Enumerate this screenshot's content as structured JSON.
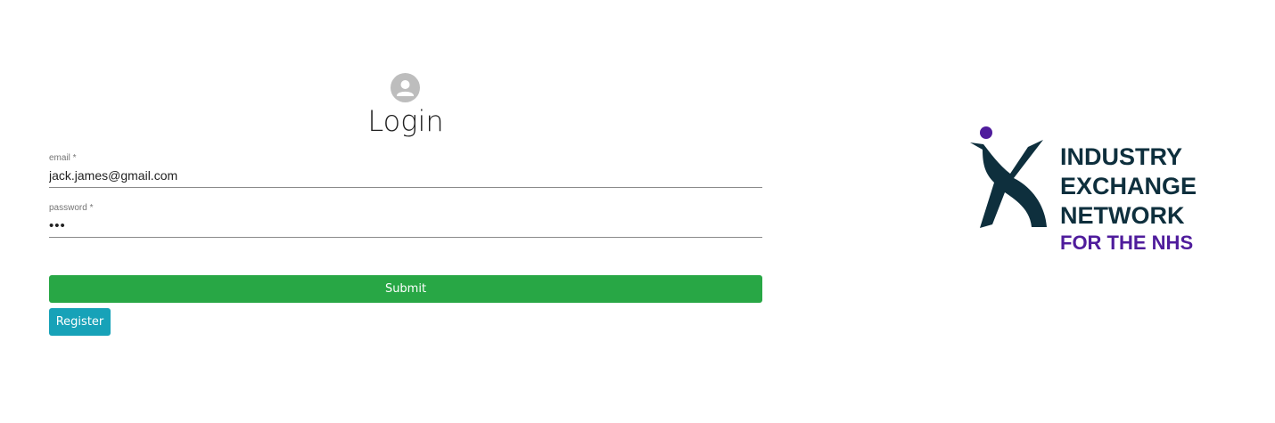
{
  "login": {
    "title": "Login",
    "avatar_icon": "account-circle-icon",
    "email": {
      "label": "email *",
      "value": "jack.james@gmail.com"
    },
    "password": {
      "label": "password *",
      "value": "abc"
    },
    "submit_label": "Submit",
    "register_label": "Register"
  },
  "logo": {
    "lines": [
      "INDUSTRY",
      "EXCHANGE",
      "NETWORK"
    ],
    "tagline": "FOR THE NHS"
  },
  "colors": {
    "submit": "#28a745",
    "register": "#17a2b8",
    "logo_dark": "#0e2f3d",
    "logo_purple": "#4f1c9c",
    "avatar": "#bdbdbd"
  }
}
